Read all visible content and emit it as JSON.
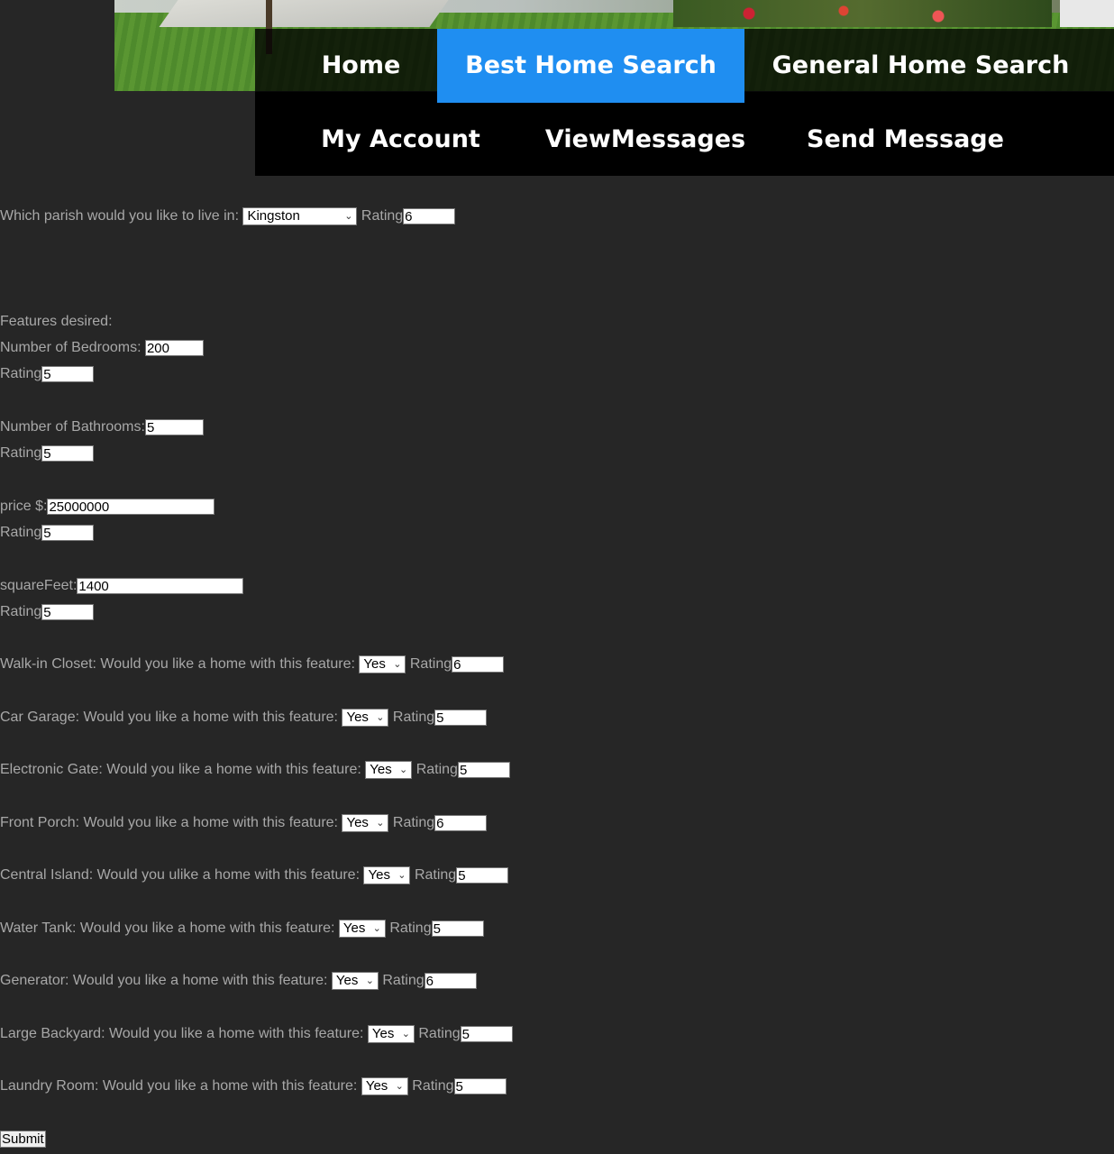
{
  "nav": {
    "home": "Home",
    "best_home_search": "Best Home Search",
    "general_home_search": "General Home Search",
    "my_account": "My Account",
    "view_messages": "ViewMessages",
    "send_message": "Send Message"
  },
  "parish": {
    "label": "Which parish would you like to live in:",
    "selected": "Kingston",
    "rating_label": "Rating",
    "rating": "6"
  },
  "features_heading": "Features desired:",
  "bedrooms": {
    "label": "Number of Bedrooms:",
    "value": "200",
    "rating_label": "Rating",
    "rating": "5"
  },
  "bathrooms": {
    "label": "Number of Bathrooms:",
    "value": "5",
    "rating_label": "Rating",
    "rating": "5"
  },
  "price": {
    "label": "price $:",
    "value": "25000000",
    "rating_label": "Rating",
    "rating": "5"
  },
  "squarefeet": {
    "label": "squareFeet:",
    "value": "1400",
    "rating_label": "Rating",
    "rating": "5"
  },
  "features": [
    {
      "label": "Walk-in Closet: Would you like a home with this feature:",
      "selected": "Yes",
      "rating_label": "Rating",
      "rating": "6"
    },
    {
      "label": "Car Garage: Would you like a home with this feature:",
      "selected": "Yes",
      "rating_label": "Rating",
      "rating": "5"
    },
    {
      "label": "Electronic Gate: Would you like a home with this feature:",
      "selected": "Yes",
      "rating_label": "Rating",
      "rating": "5"
    },
    {
      "label": "Front Porch: Would you like a home with this feature:",
      "selected": "Yes",
      "rating_label": "Rating",
      "rating": "6"
    },
    {
      "label": "Central Island: Would you ulike a home with this feature:",
      "selected": "Yes",
      "rating_label": "Rating",
      "rating": "5"
    },
    {
      "label": "Water Tank: Would you like a home with this feature:",
      "selected": "Yes",
      "rating_label": "Rating",
      "rating": "5"
    },
    {
      "label": "Generator: Would you like a home with this feature:",
      "selected": "Yes",
      "rating_label": "Rating",
      "rating": "6"
    },
    {
      "label": "Large Backyard: Would you like a home with this feature:",
      "selected": "Yes",
      "rating_label": "Rating",
      "rating": "5"
    },
    {
      "label": "Laundry Room: Would you like a home with this feature:",
      "selected": "Yes",
      "rating_label": "Rating",
      "rating": "5"
    }
  ],
  "submit_label": "Submit",
  "colors": {
    "background": "#262626",
    "text": "#a8a8a8",
    "nav_active": "#1f8ef1",
    "nav_bg": "#000000"
  }
}
